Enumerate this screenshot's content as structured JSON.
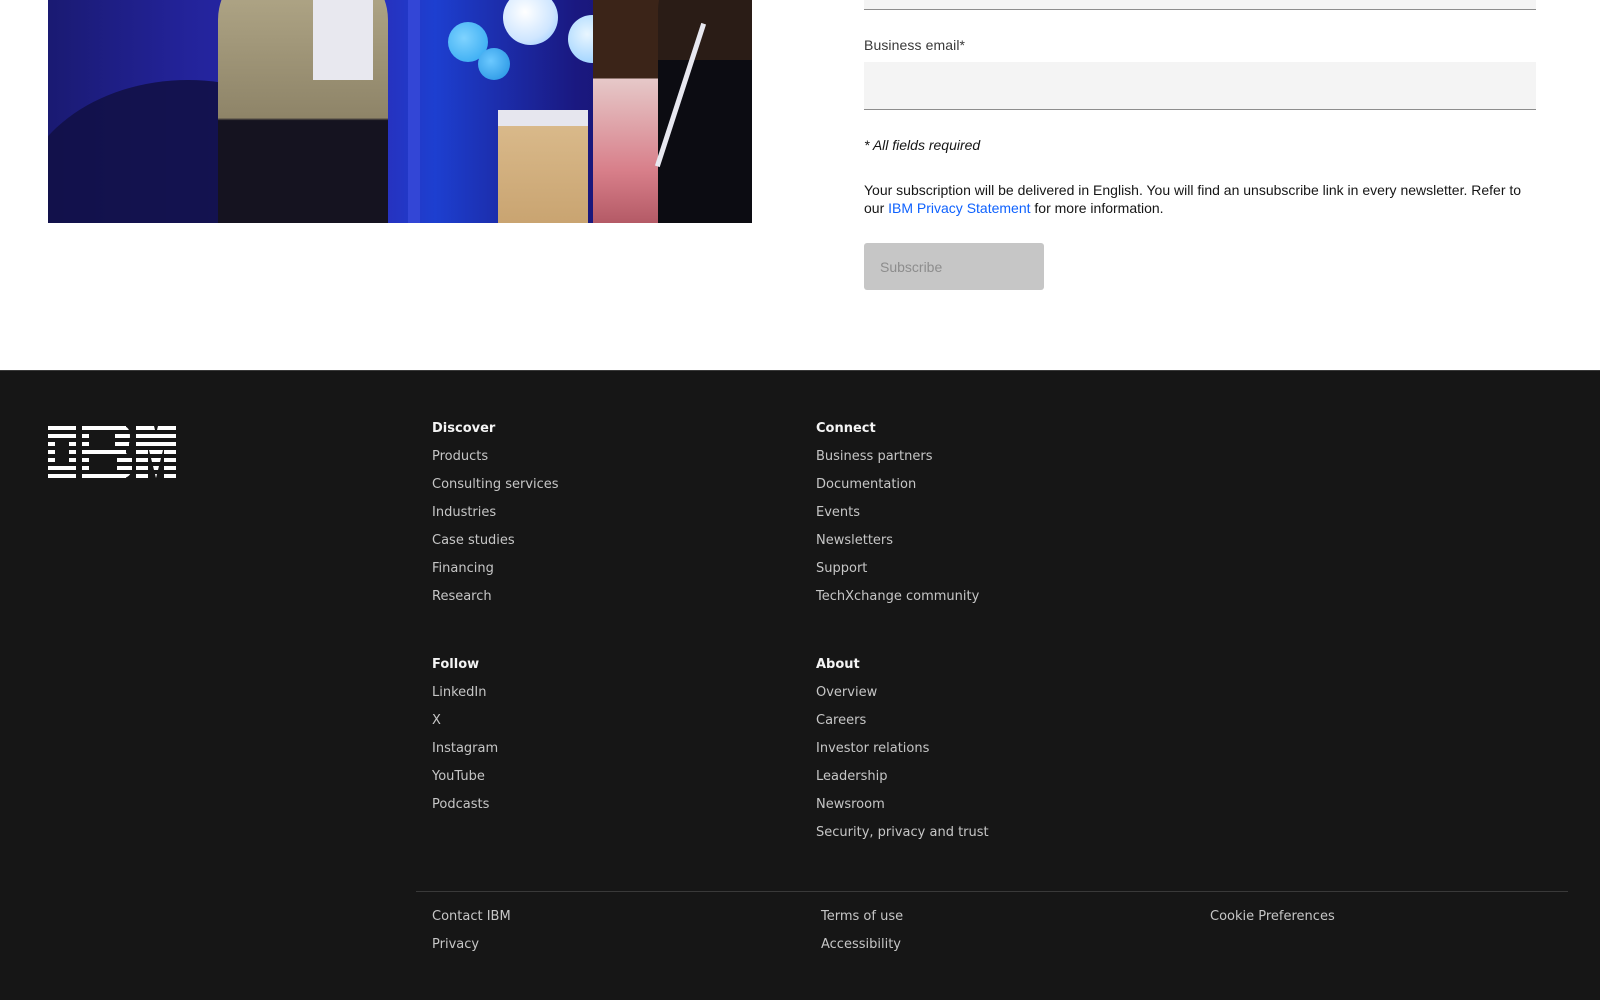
{
  "form": {
    "email_label": "Business email*",
    "email_value": "",
    "required_note": "* All fields required",
    "subscription_text_before": "Your subscription will be delivered in English. You will find an unsubscribe link in every newsletter. Refer to our ",
    "privacy_link": "IBM Privacy Statement",
    "subscription_text_after": " for more information.",
    "subscribe_label": "Subscribe"
  },
  "footer": {
    "logo_text": "IBM",
    "discover": {
      "heading": "Discover",
      "items": [
        "Products",
        "Consulting services",
        "Industries",
        "Case studies",
        "Financing",
        "Research"
      ]
    },
    "connect": {
      "heading": "Connect",
      "items": [
        "Business partners",
        "Documentation",
        "Events",
        "Newsletters",
        "Support",
        "TechXchange community"
      ]
    },
    "follow": {
      "heading": "Follow",
      "items": [
        "LinkedIn",
        "X",
        "Instagram",
        "YouTube",
        "Podcasts"
      ]
    },
    "about": {
      "heading": "About",
      "items": [
        "Overview",
        "Careers",
        "Investor relations",
        "Leadership",
        "Newsroom",
        "Security, privacy and trust"
      ]
    },
    "legal": {
      "col1": [
        "Contact IBM",
        "Privacy"
      ],
      "col2": [
        "Terms of use",
        "Accessibility"
      ],
      "col3": [
        "Cookie Preferences"
      ]
    }
  },
  "colors": {
    "footer_bg": "#161616",
    "link_blue": "#0f62fe",
    "disabled_button": "#c6c6c6"
  }
}
